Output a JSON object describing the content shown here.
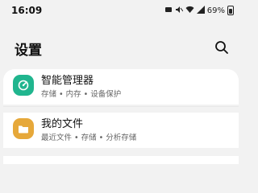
{
  "status_bar": {
    "time": "16:09",
    "battery": "69%"
  },
  "header": {
    "title": "设置",
    "search_icon": "search-icon"
  },
  "settings": [
    {
      "title": "智能管理器",
      "subtitle": "存储 • 内存 • 设备保护",
      "icon": "device-care-icon",
      "icon_color": "#20b58e"
    },
    {
      "title": "我的文件",
      "subtitle": "最近文件 • 存储 • 分析存储",
      "icon": "my-files-icon",
      "icon_color": "#e6a83a"
    }
  ]
}
